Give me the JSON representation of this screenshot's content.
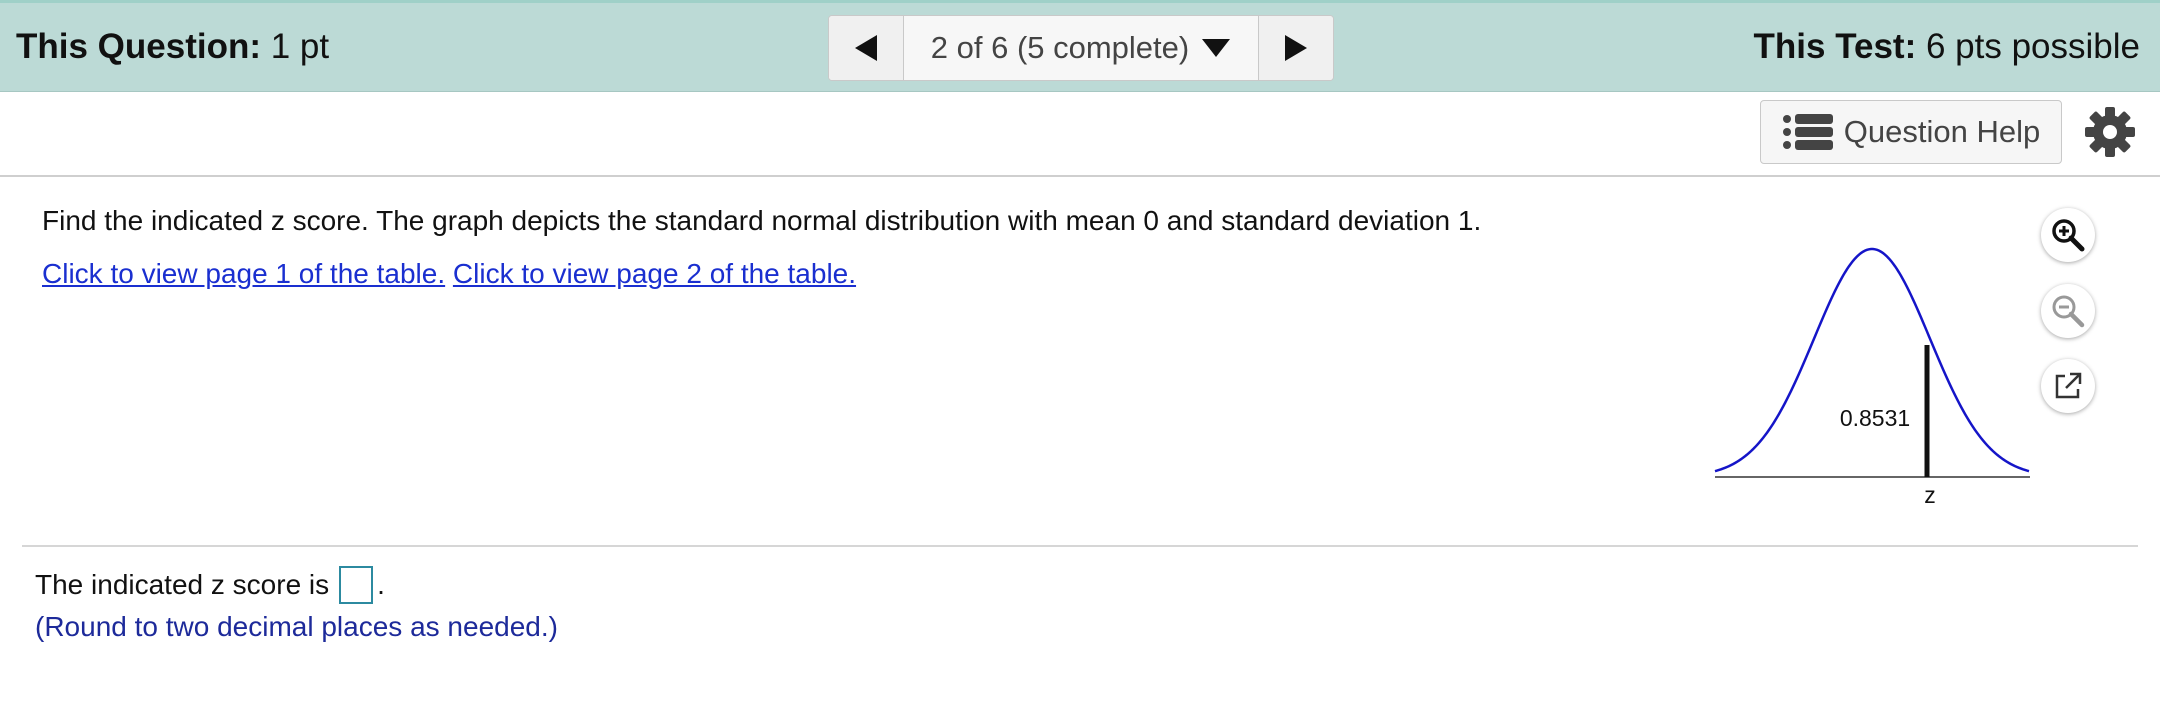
{
  "header": {
    "question_label": "This Question:",
    "question_value": " 1 pt",
    "test_label": "This Test:",
    "test_value": " 6 pts possible",
    "progress": "2 of 6 (5 complete)",
    "prev_icon": "triangle-left-icon",
    "next_icon": "triangle-right-icon",
    "dropdown_icon": "caret-down-icon"
  },
  "toolbar": {
    "help_label": "Question Help",
    "help_icon": "list-icon",
    "settings_icon": "gear-icon"
  },
  "question": {
    "prompt": "Find the indicated z score. The graph depicts the standard normal distribution with mean 0 and standard deviation 1.",
    "link1": "Click to view page 1 of the table.",
    "link2": "Click to view page 2 of the table."
  },
  "graph": {
    "area_label": "0.8531",
    "z_label": "z",
    "curve_color": "#1515c8"
  },
  "zoom_controls": {
    "zoom_in_icon": "zoom-in-icon",
    "zoom_out_icon": "zoom-out-icon",
    "popout_icon": "external-link-icon"
  },
  "answer": {
    "prefix": "The indicated z score is",
    "suffix": ".",
    "value": "",
    "hint": "(Round to two decimal places as needed.)"
  },
  "colors": {
    "header_bg": "#bcdad6",
    "link": "#1a2fd0",
    "hint": "#1d2a9a",
    "answer_border": "#2c8aa0"
  }
}
